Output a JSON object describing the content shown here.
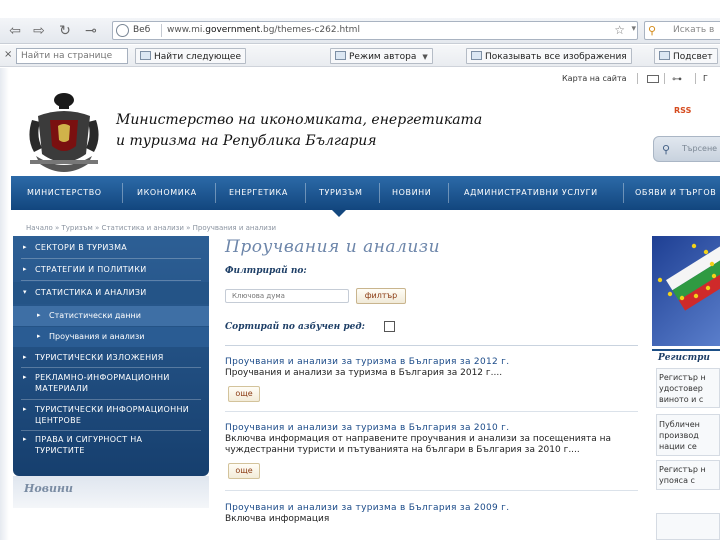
{
  "browser": {
    "back_glyph": "⇦",
    "forward_glyph": "⇨",
    "reload_glyph": "↻",
    "key_glyph": "⊸",
    "site_label": "Веб",
    "url_prefix": "www.mi.",
    "url_domain": "government",
    "url_rest": ".bg/themes-c262.html",
    "star_glyph": "☆",
    "search_placeholder": "Искать в",
    "search_glyph": "⚲"
  },
  "toolbar": {
    "close_glyph": "×",
    "find_placeholder": "Найти на странице",
    "find_next": "Найти следующее",
    "author_mode": "Режим автора",
    "show_images": "Показывать все изображения",
    "outline": "Подсвет"
  },
  "header": {
    "sitemap": "Карта на сайта",
    "key_glyph": "⊶",
    "lang": "Г",
    "rss": "RSS",
    "site_search_placeholder": "Търсене",
    "title_line1": "Министерство на икономиката, енергетиката",
    "title_line2": "и туризма на Република България"
  },
  "main_nav": [
    "МИНИСТЕРСТВО",
    "ИКОНОМИКА",
    "ЕНЕРГЕТИКА",
    "ТУРИЗЪМ",
    "НОВИНИ",
    "АДМИНИСТРАТИВНИ УСЛУГИ",
    "ОБЯВИ И ТЪРГОВ"
  ],
  "breadcrumb": "Начало » Туризъм » Статистика и анализи » Проучвания и анализи",
  "sidebar": {
    "arrow": "▸",
    "items": [
      "СЕКТОРИ В ТУРИЗМА",
      "СТРАТЕГИИ И ПОЛИТИКИ",
      "СТАТИСТИКА И АНАЛИЗИ",
      "ТУРИСТИЧЕСКИ ИЗЛОЖЕНИЯ",
      "РЕКЛАМНО-ИНФОРМАЦИОННИ МАТЕРИАЛИ",
      "ТУРИСТИЧЕСКИ ИНФОРМАЦИОННИ ЦЕНТРОВЕ",
      "ПРАВА И СИГУРНОСТ НА ТУРИСТИТЕ"
    ],
    "subitems": [
      "Статистически данни",
      "Проучвания и анализи"
    ],
    "news_title": "Новини"
  },
  "content": {
    "title": "Проучвания и анализи",
    "filter_label": "Филтрирай по:",
    "keyword_placeholder": "Ключова дума",
    "filter_button": "филтър",
    "sort_label": "Сортирай по азбучен ред:",
    "more_label": "още",
    "items": [
      {
        "title": "Проучвания и анализи за туризма в България за 2012 г.",
        "desc": "Проучвания и анализи за туризма в България за 2012 г...."
      },
      {
        "title": "Проучвания и анализи за туризма в България за 2010 г.",
        "desc": "Включва информация от направените проучвания и анализи за посещенията на чуждестранни туристи и пътуванията на българи в България за 2010 г...."
      },
      {
        "title": "Проучвания и анализи за туризма в България за 2009 г.",
        "desc": "Включва информация"
      }
    ]
  },
  "right": {
    "registers_title": "Регистри",
    "reg_lines": [
      "Регистър н",
      "удостовер",
      "виното и с"
    ],
    "pub_lines": [
      "Публичен",
      "производ",
      "нации се"
    ],
    "reg2_lines": [
      "Регистър н",
      "упояса с"
    ]
  },
  "colors": {
    "nav_blue": "#1b5590",
    "link_blue": "#1a4a88",
    "title_blue": "#6d86aa",
    "button_text": "#8a3a12",
    "rss_orange": "#d54a1d"
  }
}
